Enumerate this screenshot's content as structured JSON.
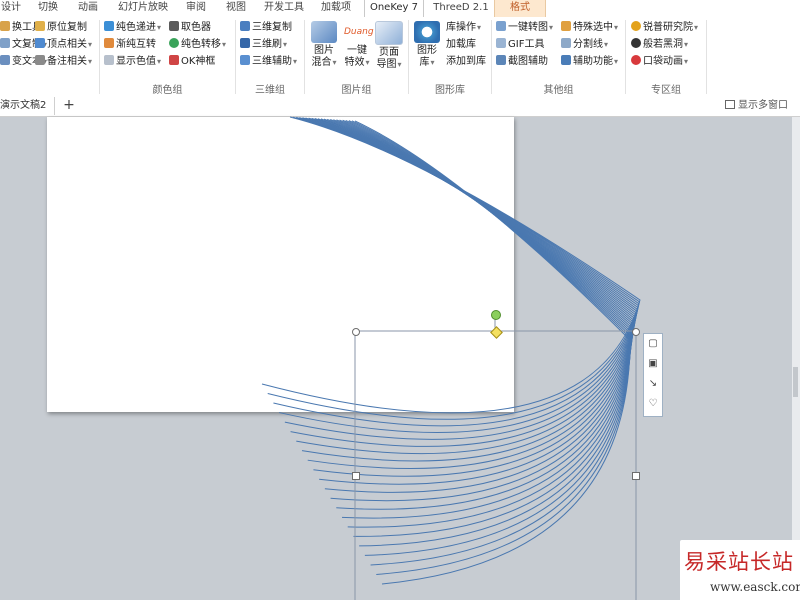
{
  "tabs": [
    "设计",
    "切换",
    "动画",
    "幻灯片放映",
    "审阅",
    "视图",
    "开发工具",
    "加载项",
    "OneKey 7",
    "ThreeD 2.1",
    "格式"
  ],
  "active_tab": "OneKey 7",
  "ribbon": {
    "col1": [
      "换工具",
      "文复制",
      "变文本"
    ],
    "col2": [
      "原位复制",
      "顶点相关",
      "备注相关"
    ],
    "col3": [
      "纯色递进",
      "渐纯互转",
      "显示色值"
    ],
    "col4": [
      "取色器",
      "纯色转移",
      "OK神框"
    ],
    "col5": [
      "三维复制",
      "三维刷",
      "三维辅助"
    ],
    "big_buttons": [
      {
        "label1": "图片",
        "label2": "混合"
      },
      {
        "label1": "一键",
        "label2": "特效"
      },
      {
        "label1": "页面",
        "label2": "导图"
      },
      {
        "label1": "图形",
        "label2": "库"
      }
    ],
    "duang_label": "Duang",
    "col6": [
      "库操作",
      "加载库",
      "添加到库"
    ],
    "col7": [
      "一键转图",
      "GIF工具",
      "截图辅助"
    ],
    "col8": [
      "特殊选中",
      "分割线",
      "辅助功能"
    ],
    "col9": [
      "锐普研究院",
      "般若黑洞",
      "口袋动画"
    ],
    "groups": [
      "颜色组",
      "三维组",
      "图片组",
      "图形库",
      "其他组",
      "专区组"
    ],
    "colors": {
      "accent": "#2b6cb0",
      "format_tab": "#fde8cf"
    }
  },
  "docbar": {
    "tab_label": "演示文稿2",
    "add_symbol": "+",
    "multiwindow": "显示多窗口"
  },
  "canvas": {
    "line_color": "#4a78b0",
    "side_icons": [
      "shape-icon",
      "image-icon",
      "resize-icon",
      "heart-icon"
    ]
  },
  "watermark": {
    "cn": "易采站长站",
    "url": "www.easck.com"
  }
}
